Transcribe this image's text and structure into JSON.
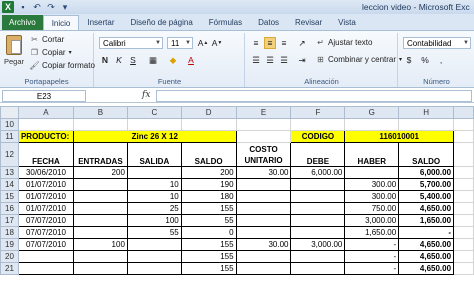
{
  "titlebar": {
    "logo": "X",
    "document_title": "leccion video - Microsoft Exc"
  },
  "tabs": [
    "Archivo",
    "Inicio",
    "Insertar",
    "Diseño de página",
    "Fórmulas",
    "Datos",
    "Revisar",
    "Vista"
  ],
  "ribbon": {
    "clipboard": {
      "paste": "Pegar",
      "cut": "Cortar",
      "copy": "Copiar",
      "copy_format": "Copiar formato",
      "group": "Portapapeles"
    },
    "font": {
      "name": "Calibri",
      "size": "11",
      "group": "Fuente"
    },
    "alignment": {
      "wrap": "Ajustar texto",
      "merge": "Combinar y centrar",
      "group": "Alineación"
    },
    "number": {
      "format": "Contabilidad",
      "group": "Número"
    }
  },
  "formula_bar": {
    "cell": "E23",
    "fx": "fx",
    "value": ""
  },
  "columns": [
    "A",
    "B",
    "C",
    "D",
    "E",
    "F",
    "G",
    "H"
  ],
  "rows": {
    "r10": {
      "num": "10"
    },
    "r11": {
      "num": "11",
      "producto_label": "PRODUCTO:",
      "producto": "Zinc 26 X 12",
      "codigo_label": "CODIGO",
      "codigo": "116010001"
    },
    "r12": {
      "num": "12",
      "h_fecha": "FECHA",
      "h_entradas": "ENTRADAS",
      "h_salida": "SALIDA",
      "h_saldo": "SALDO",
      "h_costo1": "COSTO",
      "h_costo2": "UNITARIO",
      "h_debe": "DEBE",
      "h_haber": "HABER",
      "h_saldo2": "SALDO"
    },
    "data": [
      {
        "num": "13",
        "fecha": "30/06/2010",
        "entradas": "200",
        "salida": "",
        "saldo": "200",
        "costo": "30.00",
        "debe": "6,000.00",
        "haber": "",
        "saldo2": "6,000.00"
      },
      {
        "num": "14",
        "fecha": "01/07/2010",
        "entradas": "",
        "salida": "10",
        "saldo": "190",
        "costo": "",
        "debe": "",
        "haber": "300.00",
        "saldo2": "5,700.00"
      },
      {
        "num": "15",
        "fecha": "01/07/2010",
        "entradas": "",
        "salida": "10",
        "saldo": "180",
        "costo": "",
        "debe": "",
        "haber": "300.00",
        "saldo2": "5,400.00"
      },
      {
        "num": "16",
        "fecha": "01/07/2010",
        "entradas": "",
        "salida": "25",
        "saldo": "155",
        "costo": "",
        "debe": "",
        "haber": "750.00",
        "saldo2": "4,650.00"
      },
      {
        "num": "17",
        "fecha": "07/07/2010",
        "entradas": "",
        "salida": "100",
        "saldo": "55",
        "costo": "",
        "debe": "",
        "haber": "3,000.00",
        "saldo2": "1,650.00"
      },
      {
        "num": "18",
        "fecha": "07/07/2010",
        "entradas": "",
        "salida": "55",
        "saldo": "0",
        "costo": "",
        "debe": "",
        "haber": "1,650.00",
        "saldo2": "-"
      },
      {
        "num": "19",
        "fecha": "07/07/2010",
        "entradas": "100",
        "salida": "",
        "saldo": "155",
        "costo": "30.00",
        "debe": "3,000.00",
        "haber": "-",
        "saldo2": "4,650.00"
      },
      {
        "num": "20",
        "fecha": "",
        "entradas": "",
        "salida": "",
        "saldo": "155",
        "costo": "",
        "debe": "",
        "haber": "-",
        "saldo2": "4,650.00"
      },
      {
        "num": "21",
        "fecha": "",
        "entradas": "",
        "salida": "",
        "saldo": "155",
        "costo": "",
        "debe": "",
        "haber": "-",
        "saldo2": "4,650.00"
      }
    ]
  },
  "colors": {
    "file_tab": "#2b7a3d",
    "yellow_fill": "#ffff00",
    "header_bg": "#dfe7f2"
  }
}
